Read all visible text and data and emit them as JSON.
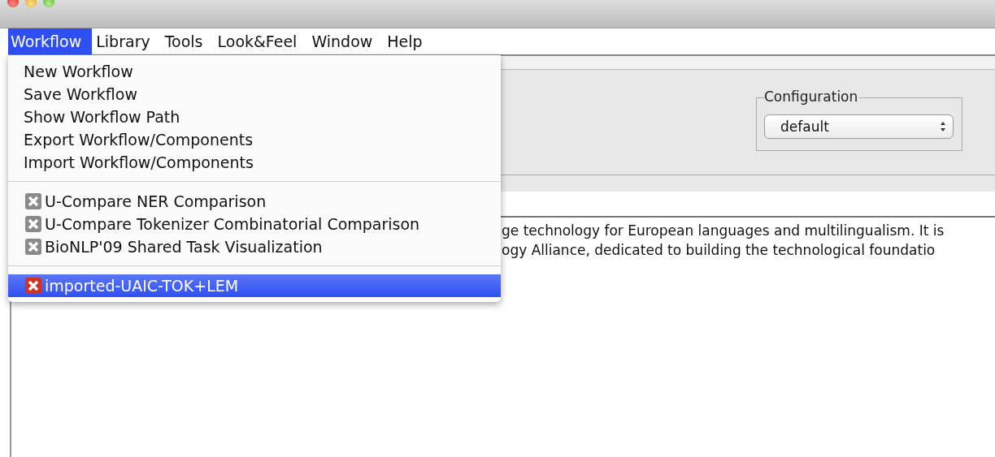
{
  "menubar": [
    {
      "label": "Workflow",
      "selected": true
    },
    {
      "label": "Library",
      "selected": false
    },
    {
      "label": "Tools",
      "selected": false
    },
    {
      "label": "Look&Feel",
      "selected": false
    },
    {
      "label": "Window",
      "selected": false
    },
    {
      "label": "Help",
      "selected": false
    }
  ],
  "menu": {
    "items": [
      {
        "kind": "item",
        "label": "New Workflow",
        "selected": false
      },
      {
        "kind": "item",
        "label": "Save Workflow",
        "selected": false
      },
      {
        "kind": "item",
        "label": "Show Workflow Path",
        "selected": false
      },
      {
        "kind": "item",
        "label": "Export Workflow/Components",
        "selected": false
      },
      {
        "kind": "item",
        "label": "Import Workflow/Components",
        "selected": false
      },
      {
        "kind": "separator"
      },
      {
        "kind": "workflow",
        "label": "U-Compare NER Comparison",
        "selected": false
      },
      {
        "kind": "workflow",
        "label": "U-Compare Tokenizer Combinatorial Comparison",
        "selected": false
      },
      {
        "kind": "workflow",
        "label": "BioNLP'09 Shared Task Visualization",
        "selected": false
      },
      {
        "kind": "separator"
      },
      {
        "kind": "workflow",
        "label": "imported-UAIC-TOK+LEM",
        "selected": true
      }
    ]
  },
  "configuration": {
    "label": "Configuration",
    "value": "default"
  },
  "description_lines": [
    "ge technology for European languages and multilingualism. It is",
    "ogy Alliance, dedicated to building the technological foundatio"
  ]
}
